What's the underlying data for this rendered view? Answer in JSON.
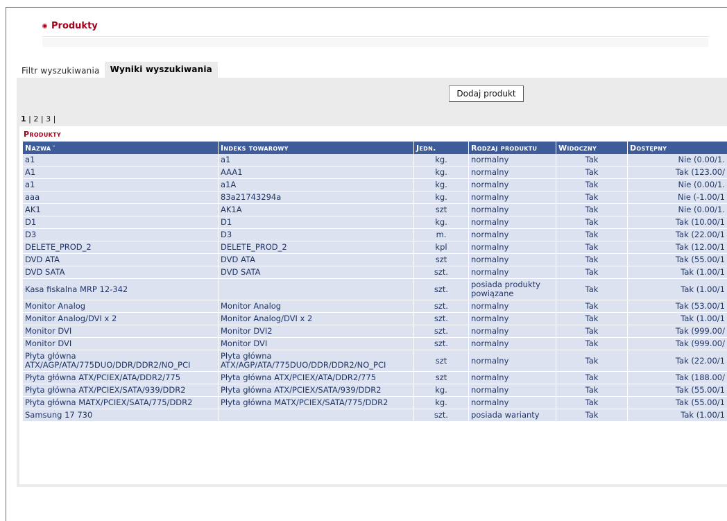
{
  "page": {
    "title": "Produkty"
  },
  "tabs": [
    {
      "label": "Filtr wyszukiwania",
      "active": false
    },
    {
      "label": "Wyniki wyszukiwania",
      "active": true
    }
  ],
  "toolbar": {
    "add_product_label": "Dodaj produkt"
  },
  "pagination": {
    "current": "1",
    "pages": [
      "2",
      "3"
    ]
  },
  "results": {
    "title": "Produkty",
    "columns": [
      "Nazwa",
      "Indeks towarowy",
      "Jedn.",
      "Rodzaj produktu",
      "Widoczny",
      "Dostępny"
    ],
    "rows": [
      [
        "a1",
        "a1",
        "kg.",
        "normalny",
        "Tak",
        "Nie (0.00/1."
      ],
      [
        "A1",
        "AAA1",
        "kg.",
        "normalny",
        "Tak",
        "Tak (123.00/"
      ],
      [
        "a1",
        "a1A",
        "kg.",
        "normalny",
        "Tak",
        "Nie (0.00/1."
      ],
      [
        "aaa",
        "83a21743294a",
        "kg.",
        "normalny",
        "Tak",
        "Nie (-1.00/1"
      ],
      [
        "AK1",
        "AK1A",
        "szt",
        "normalny",
        "Tak",
        "Nie (0.00/1."
      ],
      [
        "D1",
        "D1",
        "kg.",
        "normalny",
        "Tak",
        "Tak (10.00/1"
      ],
      [
        "D3",
        "D3",
        "m.",
        "normalny",
        "Tak",
        "Tak (22.00/1"
      ],
      [
        "DELETE_PROD_2",
        "DELETE_PROD_2",
        "kpl",
        "normalny",
        "Tak",
        "Tak (12.00/1"
      ],
      [
        "DVD ATA",
        "DVD ATA",
        "szt",
        "normalny",
        "Tak",
        "Tak (55.00/1"
      ],
      [
        "DVD SATA",
        "DVD SATA",
        "szt.",
        "normalny",
        "Tak",
        "Tak (1.00/1"
      ],
      [
        "Kasa fiskalna MRP 12-342",
        "",
        "szt.",
        "posiada produkty powiązane",
        "Tak",
        "Tak (1.00/1"
      ],
      [
        "Monitor Analog",
        "Monitor Analog",
        "szt.",
        "normalny",
        "Tak",
        "Tak (53.00/1"
      ],
      [
        "Monitor Analog/DVI x 2",
        "Monitor Analog/DVI x 2",
        "szt.",
        "normalny",
        "Tak",
        "Tak (1.00/1"
      ],
      [
        "Monitor DVI",
        "Monitor DVI2",
        "szt.",
        "normalny",
        "Tak",
        "Tak (999.00/"
      ],
      [
        "Monitor DVI",
        "Monitor DVI",
        "szt.",
        "normalny",
        "Tak",
        "Tak (999.00/"
      ],
      [
        "Płyta główna ATX/AGP/ATA/775DUO/DDR/DDR2/NO_PCI",
        "Płyta główna ATX/AGP/ATA/775DUO/DDR/DDR2/NO_PCI",
        "szt",
        "normalny",
        "Tak",
        "Tak (22.00/1"
      ],
      [
        "Płyta główna ATX/PCIEX/ATA/DDR2/775",
        "Płyta główna ATX/PCIEX/ATA/DDR2/775",
        "szt",
        "normalny",
        "Tak",
        "Tak (188.00/"
      ],
      [
        "Płyta główna ATX/PCIEX/SATA/939/DDR2",
        "Płyta główna ATX/PCIEX/SATA/939/DDR2",
        "kg.",
        "normalny",
        "Tak",
        "Tak (55.00/1"
      ],
      [
        "Płyta główna MATX/PCIEX/SATA/775/DDR2",
        "Płyta główna MATX/PCIEX/SATA/775/DDR2",
        "kg.",
        "normalny",
        "Tak",
        "Tak (55.00/1"
      ],
      [
        "Samsung 17 730",
        "",
        "szt.",
        "posiada warianty",
        "Tak",
        "Tak (1.00/1"
      ]
    ]
  },
  "colors": {
    "accent": "#a4001a",
    "header_bg": "#3e5b9a",
    "row_bg": "#dce2ef",
    "panel_bg": "#ebebeb"
  },
  "icons": {
    "title_bullet": "bullet-icon",
    "sort": "sort-desc-icon"
  }
}
